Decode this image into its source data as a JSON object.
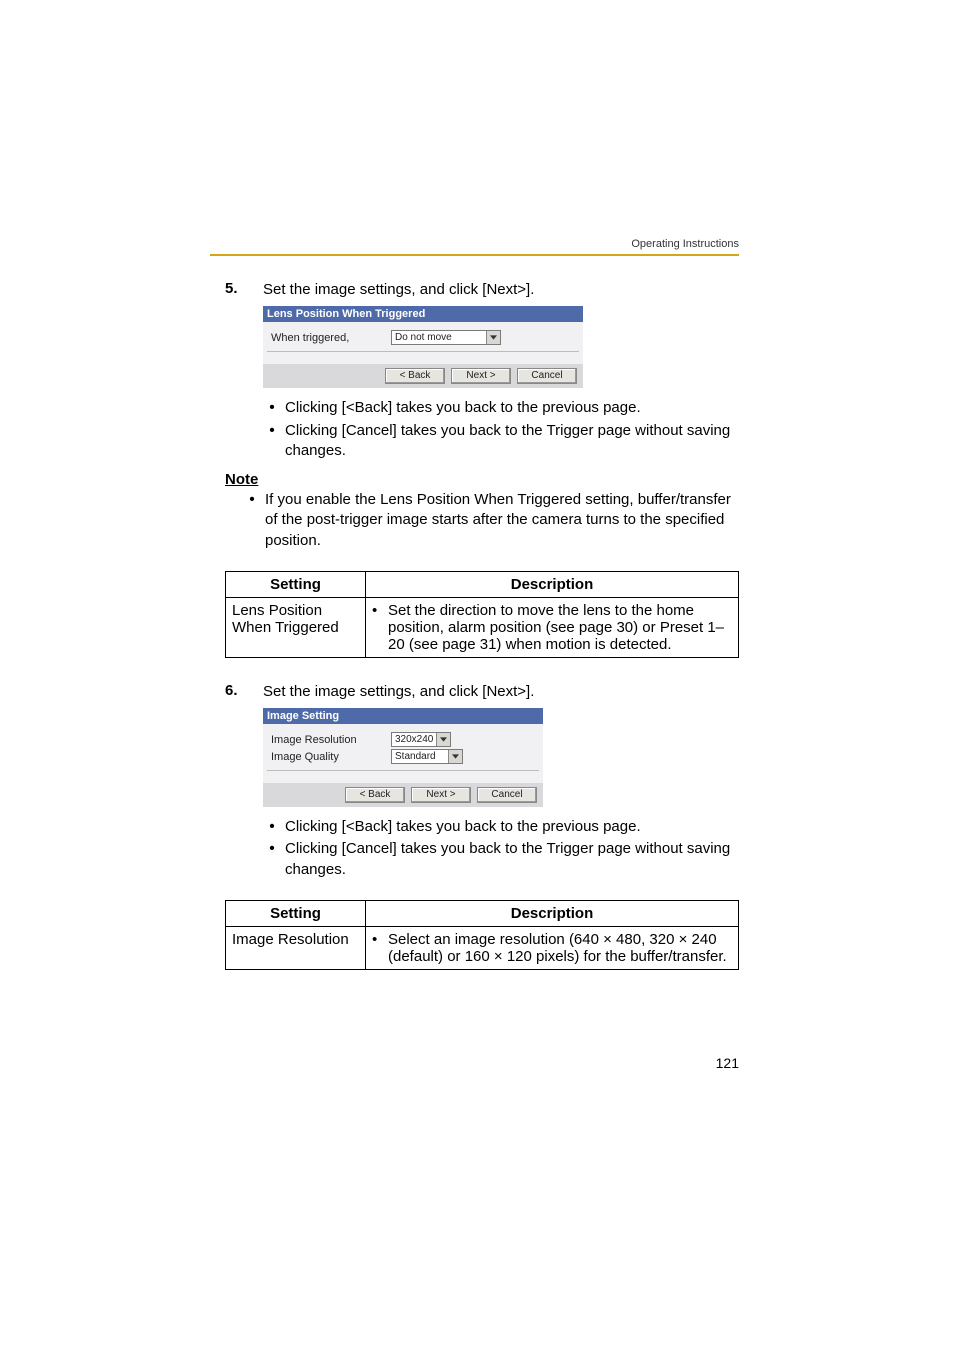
{
  "header": {
    "running_head": "Operating Instructions"
  },
  "page_number": "121",
  "step5": {
    "num": "5.",
    "text": "Set the image settings, and click [Next>].",
    "panel": {
      "title": "Lens Position When Triggered",
      "row_label": "When triggered,",
      "dropdown_value": "Do not move",
      "buttons": {
        "back": "< Back",
        "next": "Next >",
        "cancel": "Cancel"
      }
    },
    "bullets": [
      "Clicking [<Back] takes you back to the previous page.",
      "Clicking [Cancel] takes you back to the Trigger page without saving changes."
    ],
    "note_label": "Note",
    "note_bullet": "If you enable the Lens Position When Triggered setting, buffer/transfer of the post-trigger image starts after the camera turns to the specified position."
  },
  "table1": {
    "h_setting": "Setting",
    "h_desc": "Description",
    "r1_setting": "Lens Position When Triggered",
    "r1_desc": "Set the direction to move the lens to the home position, alarm position (see page 30) or Preset 1–20 (see page 31) when motion is detected."
  },
  "step6": {
    "num": "6.",
    "text": "Set the image settings, and click [Next>].",
    "panel": {
      "title": "Image Setting",
      "row1_label": "Image Resolution",
      "row1_value": "320x240",
      "row2_label": "Image Quality",
      "row2_value": "Standard",
      "buttons": {
        "back": "< Back",
        "next": "Next >",
        "cancel": "Cancel"
      }
    },
    "bullets": [
      "Clicking [<Back] takes you back to the previous page.",
      "Clicking [Cancel] takes you back to the Trigger page without saving changes."
    ]
  },
  "table2": {
    "h_setting": "Setting",
    "h_desc": "Description",
    "r1_setting": "Image Resolution",
    "r1_desc": "Select an image resolution (640 × 480, 320 × 240 (default) or 160 × 120 pixels) for the buffer/transfer."
  }
}
